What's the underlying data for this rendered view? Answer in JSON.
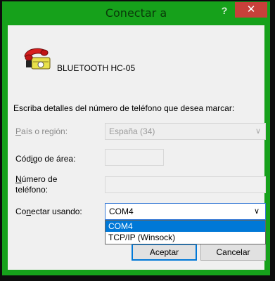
{
  "window": {
    "title": "Conectar a",
    "help_label": "?",
    "close_label": "✕"
  },
  "connection": {
    "icon": "telephone-icon",
    "name": "BLUETOOTH HC-05"
  },
  "instructions": "Escriba detalles del número de teléfono que desea marcar:",
  "fields": {
    "country": {
      "label_prefix": "P",
      "label_rest": "aís o región:",
      "value": "España (34)"
    },
    "area_code": {
      "label_prefix": "Cód",
      "label_mnemonic": "i",
      "label_rest": "go de área:",
      "value": ""
    },
    "phone": {
      "label_mnemonic": "N",
      "label_rest1": "úmero de",
      "label_line2": "teléfono:",
      "value": ""
    },
    "connect_using": {
      "label_prefix": "Co",
      "label_mnemonic": "n",
      "label_rest": "ectar usando:",
      "value": "COM4"
    }
  },
  "dropdown_options": [
    "COM4",
    "TCP/IP (Winsock)"
  ],
  "buttons": {
    "ok": "Aceptar",
    "cancel": "Cancelar"
  },
  "colors": {
    "title_bar": "#16a11b",
    "close": "#c8403a",
    "selection": "#0078d7"
  }
}
